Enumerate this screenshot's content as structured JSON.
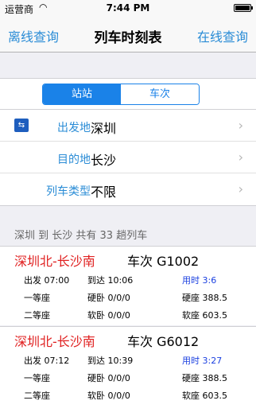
{
  "status": {
    "carrier": "运营商",
    "time": "7:44 PM"
  },
  "nav": {
    "left": "离线查询",
    "title": "列车时刻表",
    "right": "在线查询"
  },
  "segment": {
    "options": [
      "站站",
      "车次"
    ],
    "selected": "站站"
  },
  "form": {
    "from_label": "出发地",
    "from_value": "深圳",
    "to_label": "目的地",
    "to_value": "长沙",
    "type_label": "列车类型",
    "type_value": "不限"
  },
  "summary": "深圳 到 长沙 共有 33 趟列车",
  "trains": [
    {
      "route": "深圳北-长沙南",
      "number": "车次 G1002",
      "depart": "出发 07:00",
      "arrive": "到达 10:06",
      "duration": "用时 3:6",
      "first_class": "一等座",
      "hard_sleeper": "硬卧 0/0/0",
      "hard_seat": "硬座 388.5",
      "second_class": "二等座",
      "soft_sleeper": "软卧 0/0/0",
      "soft_seat": "软座 603.5"
    },
    {
      "route": "深圳北-长沙南",
      "number": "车次 G6012",
      "depart": "出发 07:12",
      "arrive": "到达 10:39",
      "duration": "用时 3:27",
      "first_class": "一等座",
      "hard_sleeper": "硬卧 0/0/0",
      "hard_seat": "硬座 388.5",
      "second_class": "二等座",
      "soft_sleeper": "软卧 0/0/0",
      "soft_seat": "软座 603.5"
    }
  ]
}
